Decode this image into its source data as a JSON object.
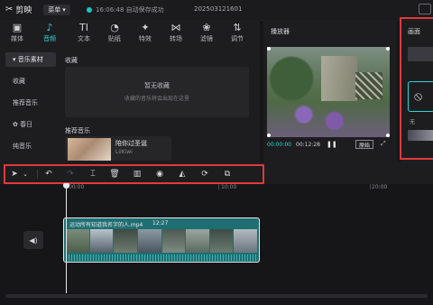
{
  "titlebar": {
    "app_name": "剪映",
    "menu_label": "菜单",
    "save_status": "16:06:48 自动保存成功",
    "project_name": "202503121601"
  },
  "tabs": [
    {
      "label": "媒体",
      "icon": "media-icon"
    },
    {
      "label": "音频",
      "icon": "audio-icon"
    },
    {
      "label": "文本",
      "icon": "text-icon"
    },
    {
      "label": "贴纸",
      "icon": "sticker-icon"
    },
    {
      "label": "特效",
      "icon": "effects-icon"
    },
    {
      "label": "转场",
      "icon": "transition-icon"
    },
    {
      "label": "滤镜",
      "icon": "filter-icon"
    },
    {
      "label": "调节",
      "icon": "adjust-icon"
    }
  ],
  "active_tab": "音频",
  "sidenav": {
    "items": [
      "▾ 音乐素材",
      "收藏",
      "推荐音乐",
      "✿ 春日",
      "纯音乐"
    ],
    "active_index": 0
  },
  "favorites": {
    "title": "收藏",
    "empty_text": "暂无收藏",
    "hint_text": "收藏的音乐将会出现在这里"
  },
  "recommended": {
    "title": "推荐音乐",
    "song_title": "陪你过圣诞",
    "song_artist": "LiiKiwi"
  },
  "player": {
    "title": "播放器",
    "current_time": "00:00:00",
    "total_time": "00:12:28",
    "original_label": "原始"
  },
  "right_panel": {
    "title": "画面",
    "none_label": "无"
  },
  "timeline": {
    "ticks": [
      "00:00",
      "10:00",
      "20:00"
    ],
    "clip_name": "运动所有知道我名字的人.mp4",
    "clip_duration": "12:27"
  },
  "colors": {
    "accent": "#2fd6d6",
    "highlight": "#e03a3a",
    "clip": "#1e6f72"
  }
}
